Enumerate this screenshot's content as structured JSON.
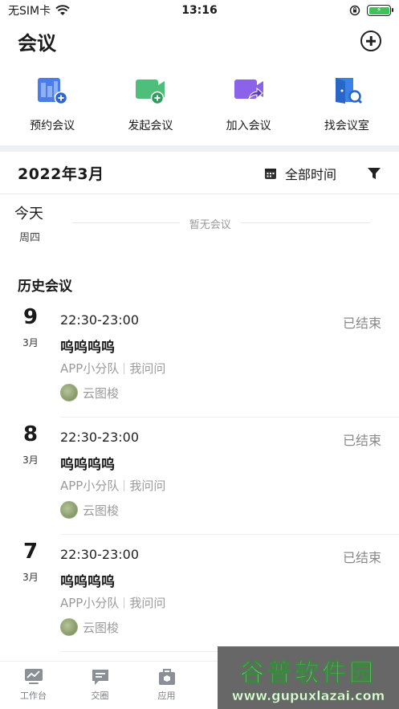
{
  "status": {
    "carrier": "无SIM卡",
    "time": "13:16"
  },
  "header": {
    "title": "会议"
  },
  "actions": [
    {
      "label": "预约会议",
      "icon": "schedule-meeting-icon",
      "color": "#4a7de8"
    },
    {
      "label": "发起会议",
      "icon": "start-meeting-icon",
      "color": "#4ebf7a"
    },
    {
      "label": "加入会议",
      "icon": "join-meeting-icon",
      "color": "#8a63e8"
    },
    {
      "label": "找会议室",
      "icon": "find-room-icon",
      "color": "#3c82e6"
    }
  ],
  "month_bar": {
    "month": "2022年3月",
    "filter_label": "全部时间"
  },
  "today": {
    "title": "今天",
    "weekday": "周四",
    "empty": "暂无会议"
  },
  "history": {
    "title": "历史会议"
  },
  "meetings": [
    {
      "day": "9",
      "month": "3月",
      "time": "22:30-23:00",
      "status": "已结束",
      "title": "呜呜呜呜",
      "team": "APP小分队",
      "tag": "我问问",
      "host": "云图梭"
    },
    {
      "day": "8",
      "month": "3月",
      "time": "22:30-23:00",
      "status": "已结束",
      "title": "呜呜呜呜",
      "team": "APP小分队",
      "tag": "我问问",
      "host": "云图梭"
    },
    {
      "day": "7",
      "month": "3月",
      "time": "22:30-23:00",
      "status": "已结束",
      "title": "呜呜呜呜",
      "team": "APP小分队",
      "tag": "我问问",
      "host": "云图梭"
    }
  ],
  "tabs": [
    {
      "label": "工作台",
      "icon": "workbench-icon"
    },
    {
      "label": "交圈",
      "icon": "chat-icon"
    },
    {
      "label": "应用",
      "icon": "apps-icon"
    }
  ],
  "watermark": {
    "main": "谷普软件园",
    "url": "www.gupuxlazai.com"
  }
}
